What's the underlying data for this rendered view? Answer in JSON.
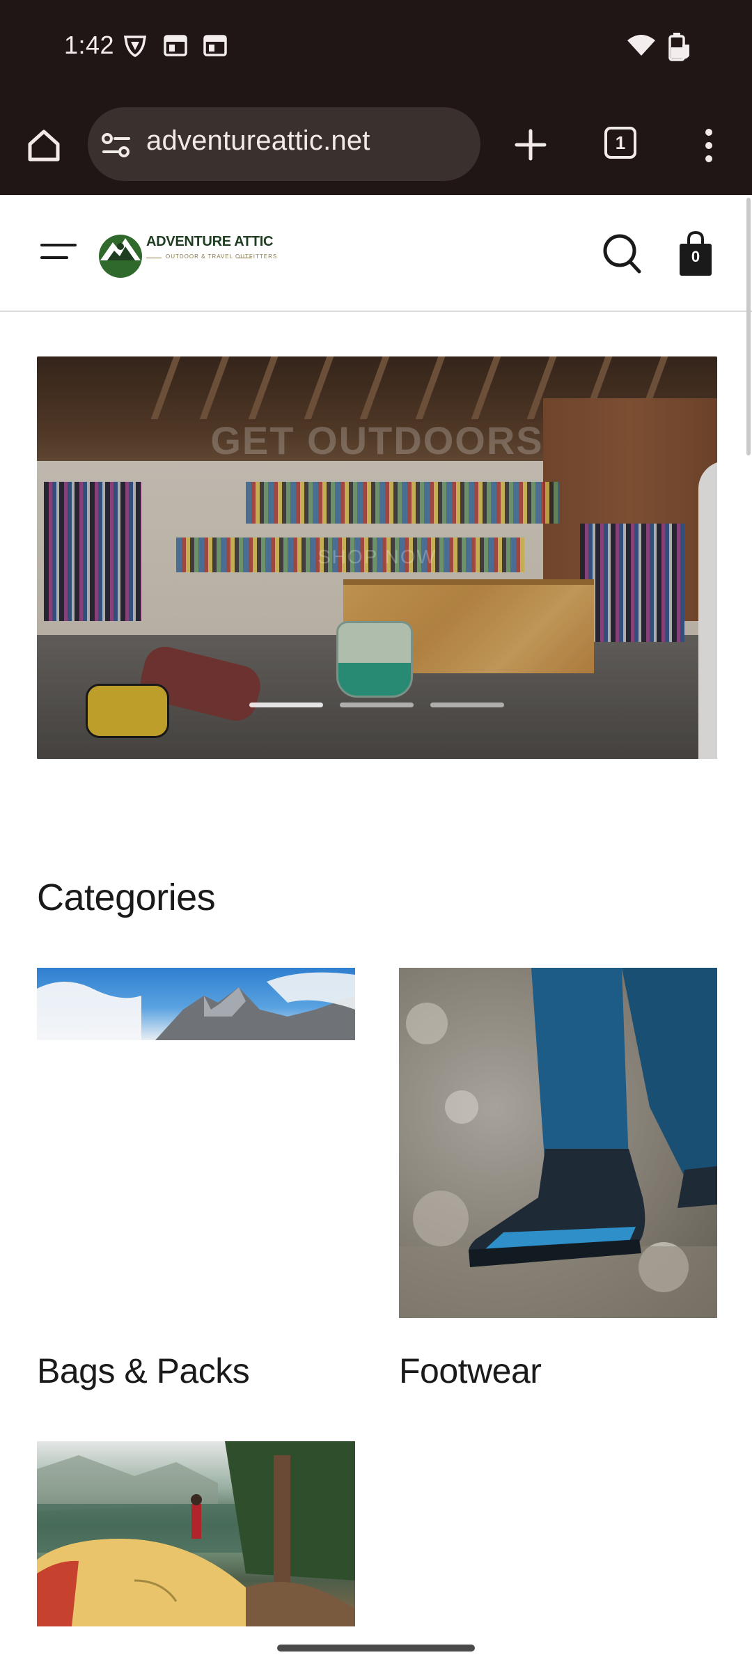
{
  "status_bar": {
    "time": "1:42"
  },
  "browser": {
    "url": "adventureattic.net",
    "tab_count": "1"
  },
  "site": {
    "logo_title": "ADVENTURE ATTIC",
    "logo_subtitle": "OUTDOOR & TRAVEL OUTFITTERS",
    "cart_count": "0"
  },
  "hero": {
    "heading": "GET OUTDOORS",
    "cta": "SHOP NOW",
    "slide_count": 3,
    "active_slide": 1
  },
  "categories": {
    "title": "Categories",
    "items": [
      {
        "label": "Bags & Packs",
        "image": "mountain-peaks-photo"
      },
      {
        "label": "Footwear",
        "image": "hiking-boot-photo"
      },
      {
        "label": "",
        "image": "tent-lake-photo"
      }
    ]
  },
  "colors": {
    "browser_chrome": "#211616",
    "url_pill": "#3a302d",
    "logo_green": "#1f3d20",
    "text": "#1a1a1a"
  }
}
